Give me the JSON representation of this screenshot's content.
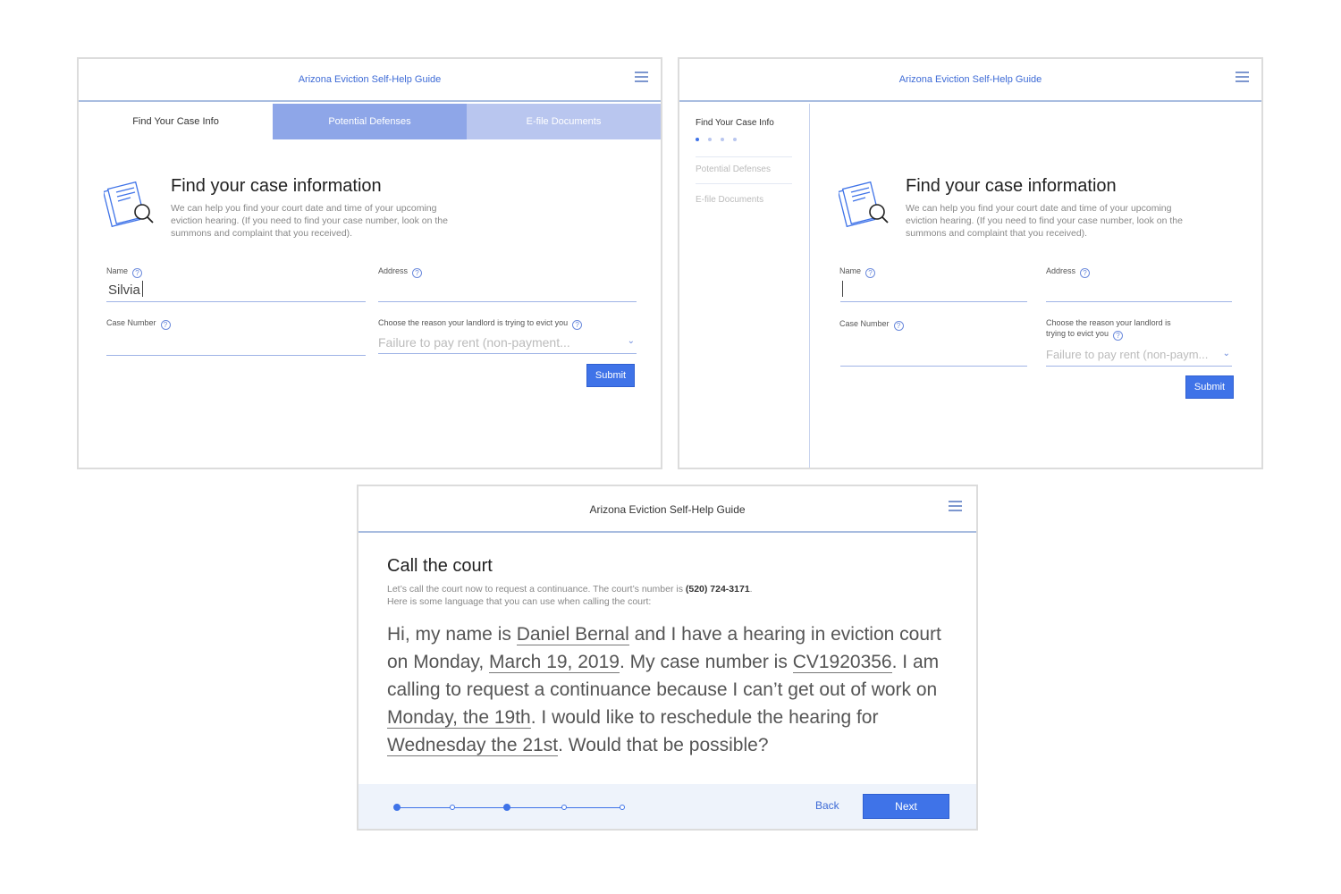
{
  "app_title": "Arizona Eviction Self-Help Guide",
  "frame1": {
    "tabs": [
      "Find Your Case Info",
      "Potential Defenses",
      "E-file Documents"
    ],
    "section_title": "Find your case information",
    "section_desc": "We can help you find your court date and time of your upcoming eviction hearing. (If you need to find your case number, look on the summons and complaint that you received).",
    "name_label": "Name",
    "name_value": "Silvia",
    "address_label": "Address",
    "case_number_label": "Case Number",
    "reason_label": "Choose the reason your landlord is trying to evict you",
    "reason_value": "Failure to pay rent (non-payment...",
    "submit_label": "Submit"
  },
  "frame2": {
    "sidebar": [
      "Find Your Case Info",
      "Potential Defenses",
      "E-file Documents"
    ],
    "section_title": "Find your case information",
    "section_desc": "We can help you find your court date and time of your upcoming eviction hearing. (If you need to find your case number, look on the summons and complaint that you received).",
    "name_label": "Name",
    "address_label": "Address",
    "case_number_label": "Case Number",
    "reason_label": "Choose the reason your landlord is trying to evict you",
    "reason_value": "Failure to pay rent (non-paym...",
    "submit_label": "Submit"
  },
  "frame3": {
    "title": "Call the court",
    "desc_before": "Let’s call the court now to request a continuance. The court’s number is ",
    "phone": "(520) 724-3171",
    "desc_after": ".",
    "desc_line2": "Here is some language that you can use when calling the court:",
    "script": {
      "p1": "Hi, my name is ",
      "name": "Daniel Bernal",
      "p2": " and I have a hearing in eviction court on Monday, ",
      "date": "March 19, 2019",
      "p3": ". My case number is ",
      "case": "CV1920356",
      "p4": ". I am calling to request a continuance because I can’t get out of work on ",
      "day": "Monday, the 19th",
      "p5": ". I would like to reschedule the hearing for ",
      "new_day": "Wednesday the 21st",
      "p6": ". Would that be possible?"
    },
    "back_label": "Back",
    "next_label": "Next",
    "progress": {
      "steps": 5,
      "current": 3
    }
  },
  "colors": {
    "accent": "#3f73e8",
    "tab_mid": "#8ea6e8",
    "tab_light": "#b9c6ef"
  },
  "icons": [
    "menu-icon",
    "document-search-icon",
    "help-icon",
    "chevron-down-icon"
  ]
}
